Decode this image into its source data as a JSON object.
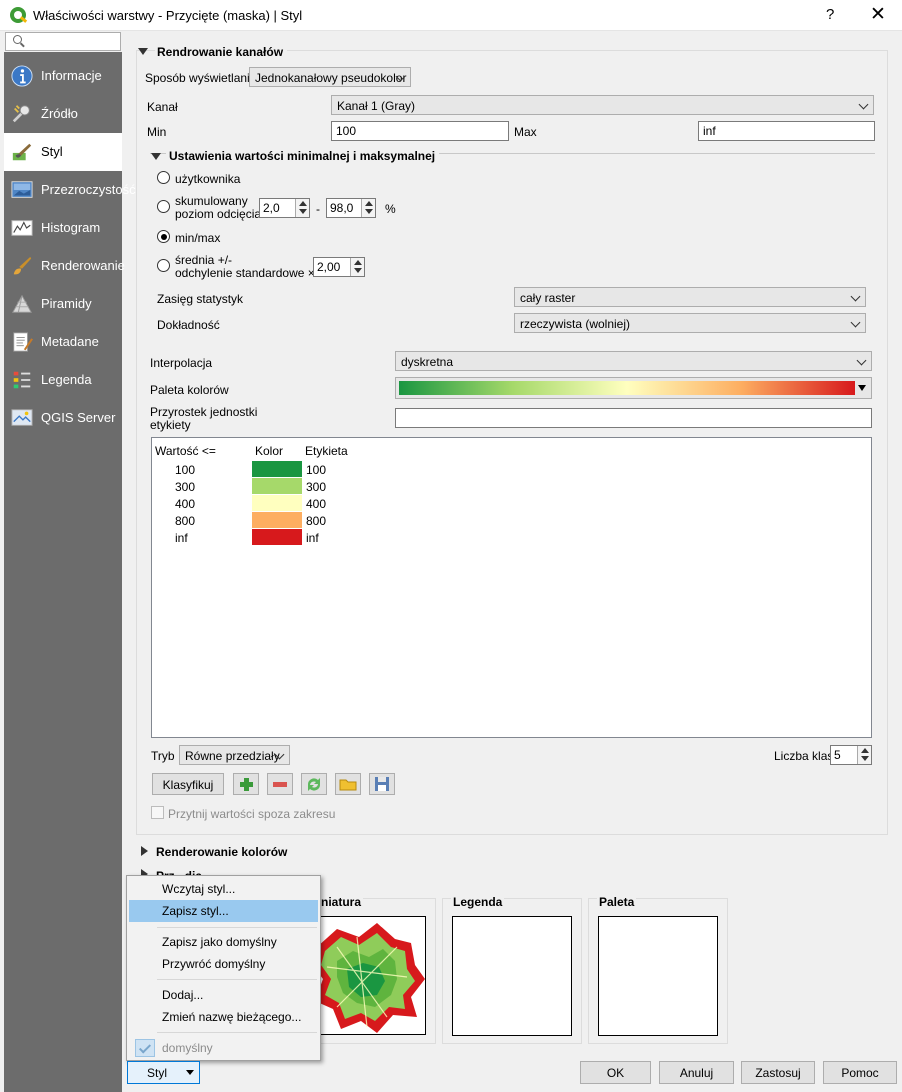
{
  "window": {
    "title": "Właściwości warstwy - Przycięte (maska) | Styl",
    "help": "?",
    "close": "✕"
  },
  "search": {
    "placeholder": ""
  },
  "sidebar": {
    "items": [
      {
        "label": "Informacje",
        "icon": "info-icon"
      },
      {
        "label": "Źródło",
        "icon": "source-wrench-icon"
      },
      {
        "label": "Styl",
        "icon": "style-brush-icon",
        "active": true
      },
      {
        "label": "Przezroczystość",
        "icon": "transparency-icon"
      },
      {
        "label": "Histogram",
        "icon": "histogram-icon"
      },
      {
        "label": "Renderowanie",
        "icon": "render-brush-icon"
      },
      {
        "label": "Piramidy",
        "icon": "pyramids-icon"
      },
      {
        "label": "Metadane",
        "icon": "metadata-icon"
      },
      {
        "label": "Legenda",
        "icon": "legend-icon"
      },
      {
        "label": "QGIS Server",
        "icon": "server-icon"
      }
    ]
  },
  "band_rendering": {
    "header": "Rendrowanie kanałów",
    "render_type_label": "Sposób wyświetlania",
    "render_type_value": "Jednokanałowy pseudokolor",
    "band_label": "Kanał",
    "band_value": "Kanał 1 (Gray)",
    "min_label": "Min",
    "min_value": "100",
    "max_label": "Max",
    "max_value": "inf"
  },
  "minmax": {
    "header": "Ustawienia wartości minimalnej i maksymalnej",
    "user_defined": "użytkownika",
    "cumulative_line1": "skumulowany",
    "cumulative_line2": "poziom odcięcia",
    "cum_low": "2,0",
    "cum_dash": "-",
    "cum_high": "98,0",
    "percent": "%",
    "minmax": "min/max",
    "stddev_line1": "średnia +/-",
    "stddev_line2": "odchylenie standardowe ×",
    "stddev_value": "2,00",
    "extent_label": "Zasięg statystyk",
    "extent_value": "cały raster",
    "accuracy_label": "Dokładność",
    "accuracy_value": "rzeczywista (wolniej)",
    "selected": "min/max"
  },
  "interpolation": {
    "label": "Interpolacja",
    "value": "dyskretna"
  },
  "color_ramp": {
    "label": "Paleta kolorów",
    "colors": [
      "#1a9641",
      "#a6d96a",
      "#ffffbf",
      "#fdae61",
      "#d7191c"
    ]
  },
  "label_unit": {
    "label_line1": "Przyrostek jednostki",
    "label_line2": "etykiety",
    "value": ""
  },
  "class_table": {
    "headers": [
      "Wartość <=",
      "Kolor",
      "Etykieta"
    ],
    "rows": [
      {
        "value": "100",
        "color": "#1a9641",
        "label": "100"
      },
      {
        "value": "300",
        "color": "#a6d96a",
        "label": "300"
      },
      {
        "value": "400",
        "color": "#ffffbf",
        "label": "400"
      },
      {
        "value": "800",
        "color": "#fdae61",
        "label": "800"
      },
      {
        "value": "inf",
        "color": "#d7191c",
        "label": "inf"
      }
    ]
  },
  "mode": {
    "label": "Tryb",
    "value": "Równe przedziały",
    "classes_label": "Liczba klas",
    "classes_value": "5"
  },
  "toolbar": {
    "classify": "Klasyfikuj"
  },
  "clip": {
    "label": "Przytnij wartości spoza zakresu",
    "checked": false
  },
  "color_rendering": {
    "header": "Renderowanie kolorów"
  },
  "resampling": {
    "header_partial": "Prz...dja"
  },
  "preview": {
    "thumbnail": "niatura",
    "legend": "Legenda",
    "palette": "Paleta"
  },
  "popup_menu": {
    "items": [
      {
        "label": "Wczytaj styl..."
      },
      {
        "label": "Zapisz styl...",
        "highlighted": true
      },
      {
        "label": "Zapisz jako domyślny"
      },
      {
        "label": "Przywróć domyślny"
      },
      {
        "label": "Dodaj..."
      },
      {
        "label": "Zmień nazwę bieżącego..."
      },
      {
        "label": "domyślny",
        "checked": true,
        "disabled": true
      }
    ]
  },
  "footer": {
    "style_button": "Styl",
    "ok": "OK",
    "cancel": "Anuluj",
    "apply": "Zastosuj",
    "help": "Pomoc"
  }
}
